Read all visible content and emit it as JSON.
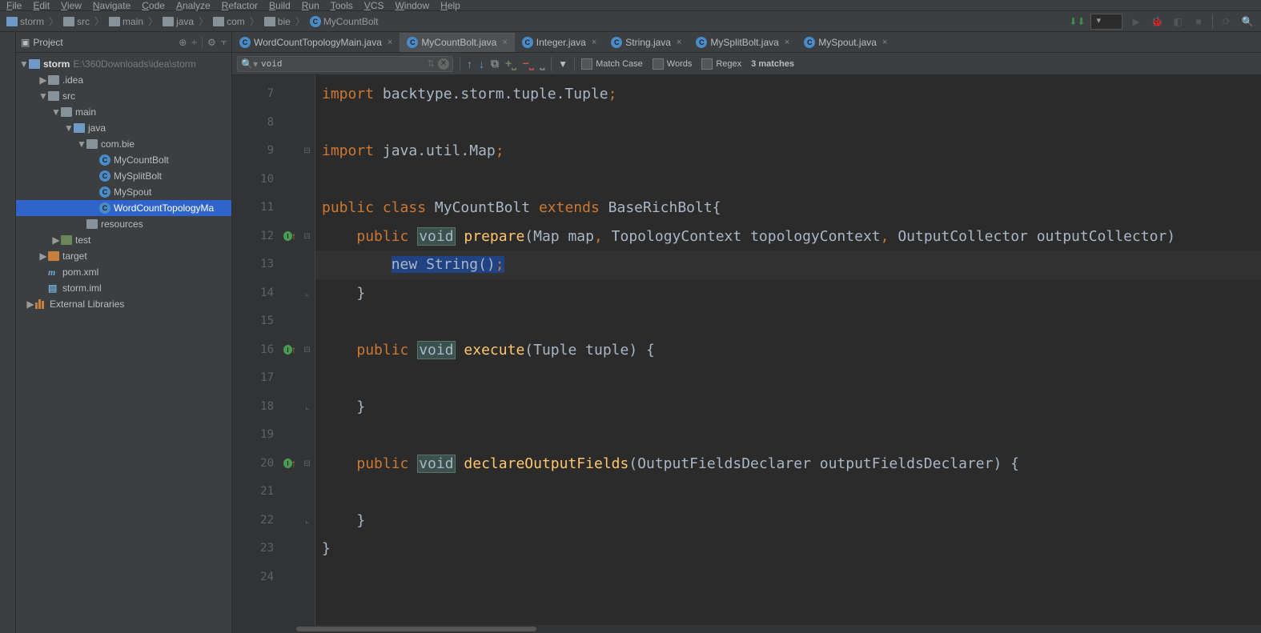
{
  "menu": [
    "File",
    "Edit",
    "View",
    "Navigate",
    "Code",
    "Analyze",
    "Refactor",
    "Build",
    "Run",
    "Tools",
    "VCS",
    "Window",
    "Help"
  ],
  "breadcrumb": [
    {
      "label": "storm",
      "icon": "module"
    },
    {
      "label": "src",
      "icon": "folder"
    },
    {
      "label": "main",
      "icon": "folder"
    },
    {
      "label": "java",
      "icon": "folder"
    },
    {
      "label": "com",
      "icon": "folder"
    },
    {
      "label": "bie",
      "icon": "folder"
    },
    {
      "label": "MyCountBolt",
      "icon": "class"
    }
  ],
  "run_config_placeholder": "",
  "project": {
    "title": "Project",
    "root": {
      "label": "storm",
      "hint": "E:\\360Downloads\\idea\\storm"
    },
    "tree": [
      {
        "label": ".idea",
        "depth": 1,
        "collapsed": true,
        "icon": "folder"
      },
      {
        "label": "src",
        "depth": 1,
        "collapsed": false,
        "icon": "folder"
      },
      {
        "label": "main",
        "depth": 2,
        "collapsed": false,
        "icon": "folder"
      },
      {
        "label": "java",
        "depth": 3,
        "collapsed": false,
        "icon": "folder-src"
      },
      {
        "label": "com.bie",
        "depth": 4,
        "collapsed": false,
        "icon": "folder"
      },
      {
        "label": "MyCountBolt",
        "depth": 5,
        "icon": "class"
      },
      {
        "label": "MySplitBolt",
        "depth": 5,
        "icon": "class"
      },
      {
        "label": "MySpout",
        "depth": 5,
        "icon": "class"
      },
      {
        "label": "WordCountTopologyMain",
        "depth": 5,
        "icon": "class",
        "selected": true,
        "truncate": "WordCountTopologyMa"
      },
      {
        "label": "resources",
        "depth": 4,
        "icon": "folder"
      },
      {
        "label": "test",
        "depth": 2,
        "collapsed": true,
        "icon": "folder-test"
      },
      {
        "label": "target",
        "depth": 1,
        "collapsed": true,
        "icon": "folder-target"
      },
      {
        "label": "pom.xml",
        "depth": 1,
        "icon": "maven"
      },
      {
        "label": "storm.iml",
        "depth": 1,
        "icon": "module-file"
      },
      {
        "label": "External Libraries",
        "depth": 0,
        "collapsed": true,
        "icon": "lib"
      }
    ]
  },
  "tabs": [
    {
      "label": "WordCountTopologyMain.java",
      "icon": "class"
    },
    {
      "label": "MyCountBolt.java",
      "icon": "class",
      "active": true
    },
    {
      "label": "Integer.java",
      "icon": "class"
    },
    {
      "label": "String.java",
      "icon": "class"
    },
    {
      "label": "MySplitBolt.java",
      "icon": "class"
    },
    {
      "label": "MySpout.java",
      "icon": "class"
    }
  ],
  "search": {
    "value": "void",
    "match_case": "Match Case",
    "words": "Words",
    "regex": "Regex",
    "matches": "3 matches"
  },
  "code": {
    "lines": [
      {
        "n": 7,
        "tokens": [
          {
            "t": "import ",
            "c": "kw"
          },
          {
            "t": "backtype.storm.tuple.Tuple"
          },
          {
            "t": ";",
            "c": "semi"
          }
        ]
      },
      {
        "n": 8,
        "tokens": []
      },
      {
        "n": 9,
        "tokens": [
          {
            "t": "import ",
            "c": "kw"
          },
          {
            "t": "java.util.Map"
          },
          {
            "t": ";",
            "c": "semi"
          }
        ],
        "fold": "open"
      },
      {
        "n": 10,
        "tokens": []
      },
      {
        "n": 11,
        "tokens": [
          {
            "t": "public class ",
            "c": "kw"
          },
          {
            "t": "MyCountBolt "
          },
          {
            "t": "extends ",
            "c": "kw"
          },
          {
            "t": "BaseRichBolt{"
          }
        ]
      },
      {
        "n": 12,
        "tokens": [
          {
            "t": "    "
          },
          {
            "t": "public ",
            "c": "kw"
          },
          {
            "t": "void",
            "c": "hl-void"
          },
          {
            "t": " "
          },
          {
            "t": "prepare",
            "c": "method"
          },
          {
            "t": "(Map map"
          },
          {
            "t": ", ",
            "c": "semi"
          },
          {
            "t": "TopologyContext topologyContext"
          },
          {
            "t": ", ",
            "c": "semi"
          },
          {
            "t": "OutputCollector outputCollector)"
          }
        ],
        "mark": "override",
        "fold": "open"
      },
      {
        "n": 13,
        "tokens": [
          {
            "t": "        "
          },
          {
            "t": "new ",
            "c": "kw",
            "sel": true
          },
          {
            "t": "String()",
            "sel": true
          },
          {
            "t": ";",
            "c": "semi",
            "sel": true
          }
        ],
        "current": true
      },
      {
        "n": 14,
        "tokens": [
          {
            "t": "    }"
          }
        ],
        "fold": "close"
      },
      {
        "n": 15,
        "tokens": []
      },
      {
        "n": 16,
        "tokens": [
          {
            "t": "    "
          },
          {
            "t": "public ",
            "c": "kw"
          },
          {
            "t": "void",
            "c": "hl-void"
          },
          {
            "t": " "
          },
          {
            "t": "execute",
            "c": "method"
          },
          {
            "t": "(Tuple tuple) {"
          }
        ],
        "mark": "override",
        "fold": "open"
      },
      {
        "n": 17,
        "tokens": []
      },
      {
        "n": 18,
        "tokens": [
          {
            "t": "    }"
          }
        ],
        "fold": "close"
      },
      {
        "n": 19,
        "tokens": []
      },
      {
        "n": 20,
        "tokens": [
          {
            "t": "    "
          },
          {
            "t": "public ",
            "c": "kw"
          },
          {
            "t": "void",
            "c": "hl-void"
          },
          {
            "t": " "
          },
          {
            "t": "declareOutputFields",
            "c": "method"
          },
          {
            "t": "(OutputFieldsDeclarer outputFieldsDeclarer) {"
          }
        ],
        "mark": "override",
        "fold": "open"
      },
      {
        "n": 21,
        "tokens": []
      },
      {
        "n": 22,
        "tokens": [
          {
            "t": "    }"
          }
        ],
        "fold": "close"
      },
      {
        "n": 23,
        "tokens": [
          {
            "t": "}"
          }
        ]
      },
      {
        "n": 24,
        "tokens": []
      }
    ]
  }
}
